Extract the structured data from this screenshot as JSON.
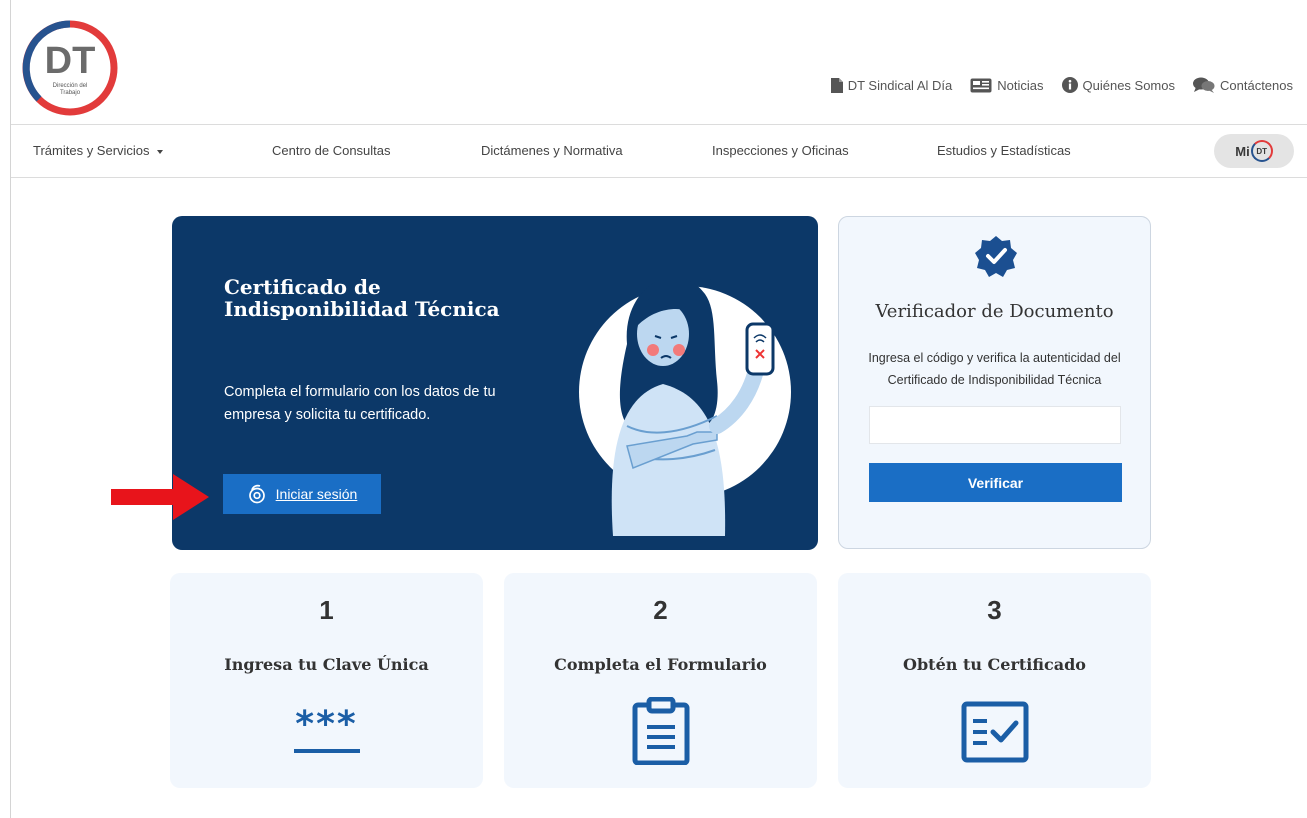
{
  "logo": {
    "text": "DT",
    "subtitle_line1": "Dirección del",
    "subtitle_line2": "Trabajo"
  },
  "top_links": [
    {
      "label": "DT Sindical Al Día",
      "icon": "document-icon"
    },
    {
      "label": "Noticias",
      "icon": "newspaper-icon"
    },
    {
      "label": "Quiénes Somos",
      "icon": "info-icon"
    },
    {
      "label": "Contáctenos",
      "icon": "chat-icon"
    }
  ],
  "nav": {
    "items": [
      {
        "label": "Trámites y Servicios"
      },
      {
        "label": "Centro de Consultas"
      },
      {
        "label": "Dictámenes y Normativa"
      },
      {
        "label": "Inspecciones y Oficinas"
      },
      {
        "label": "Estudios y Estadísticas"
      }
    ],
    "midt_mi": "Mi",
    "midt_dt": "DT"
  },
  "hero": {
    "title": "Certificado de Indisponibilidad Técnica",
    "description": "Completa el formulario con los datos de tu empresa y solicita tu certificado.",
    "login_label": "Iniciar sesión"
  },
  "verifier": {
    "title": "Verificador de Documento",
    "description": "Ingresa el código y verifica la autenticidad del Certificado de Indisponibilidad Técnica",
    "input_value": "",
    "button_label": "Verificar"
  },
  "steps": [
    {
      "number": "1",
      "title": "Ingresa tu Clave Única",
      "icon": "password-icon",
      "icon_text": "***"
    },
    {
      "number": "2",
      "title": "Completa el Formulario",
      "icon": "clipboard-icon"
    },
    {
      "number": "3",
      "title": "Obtén tu Certificado",
      "icon": "checklist-icon"
    }
  ],
  "colors": {
    "hero_bg": "#0c3868",
    "primary_button": "#1a6ec5",
    "card_bg": "#f2f7fd",
    "arrow": "#e8141b",
    "logo_red": "#e23b3b",
    "logo_blue": "#27538f"
  }
}
